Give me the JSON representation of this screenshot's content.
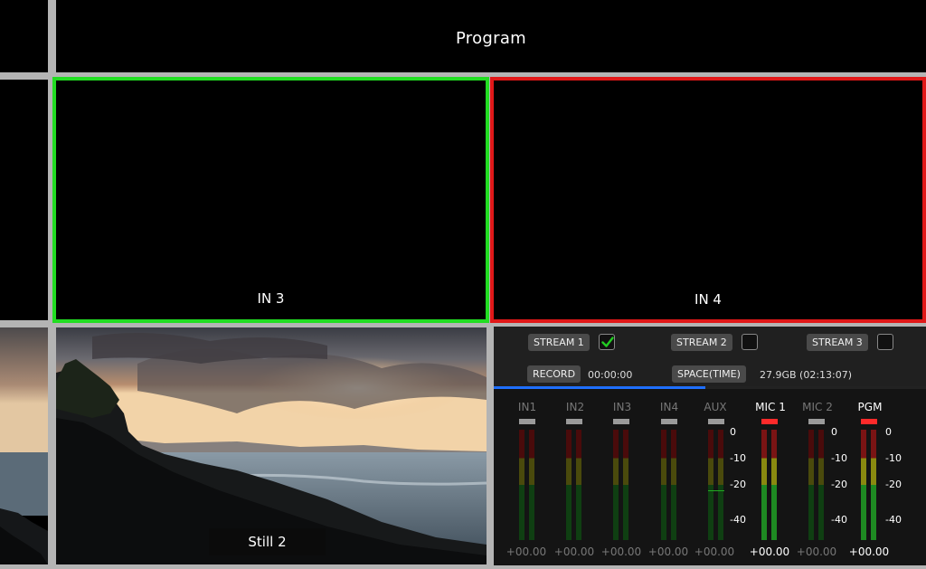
{
  "multiview": {
    "program_label": "Program",
    "in3_label": "IN 3",
    "in4_label": "IN 4",
    "still_label": "Still 2",
    "colors": {
      "preview_border": "#22dd22",
      "program_border": "#e01818",
      "background": "#000000",
      "divider": "#b4b4b4"
    }
  },
  "stream": {
    "items": [
      {
        "label": "STREAM 1",
        "checked": true
      },
      {
        "label": "STREAM 2",
        "checked": false
      },
      {
        "label": "STREAM 3",
        "checked": false
      }
    ],
    "checkmark_icon": "check-icon",
    "checkmark_color": "#22cc22"
  },
  "record": {
    "label": "RECORD",
    "time": "00:00:00",
    "space_label": "SPACE(TIME)",
    "space_value": "27.9GB (02:13:07)",
    "progress_fraction": 0.49,
    "progress_color": "#1f6fff"
  },
  "audio": {
    "channels": [
      {
        "name": "IN1",
        "value": "+00.00",
        "active": false
      },
      {
        "name": "IN2",
        "value": "+00.00",
        "active": false
      },
      {
        "name": "IN3",
        "value": "+00.00",
        "active": false
      },
      {
        "name": "IN4",
        "value": "+00.00",
        "active": false
      },
      {
        "name": "AUX",
        "value": "+00.00",
        "active": false
      },
      {
        "name": "MIC 1",
        "value": "+00.00",
        "active": true
      },
      {
        "name": "MIC 2",
        "value": "+00.00",
        "active": false
      },
      {
        "name": "PGM",
        "value": "+00.00",
        "active": true
      }
    ],
    "scale_ticks": [
      "0",
      "-10",
      "-20",
      "-40"
    ]
  }
}
